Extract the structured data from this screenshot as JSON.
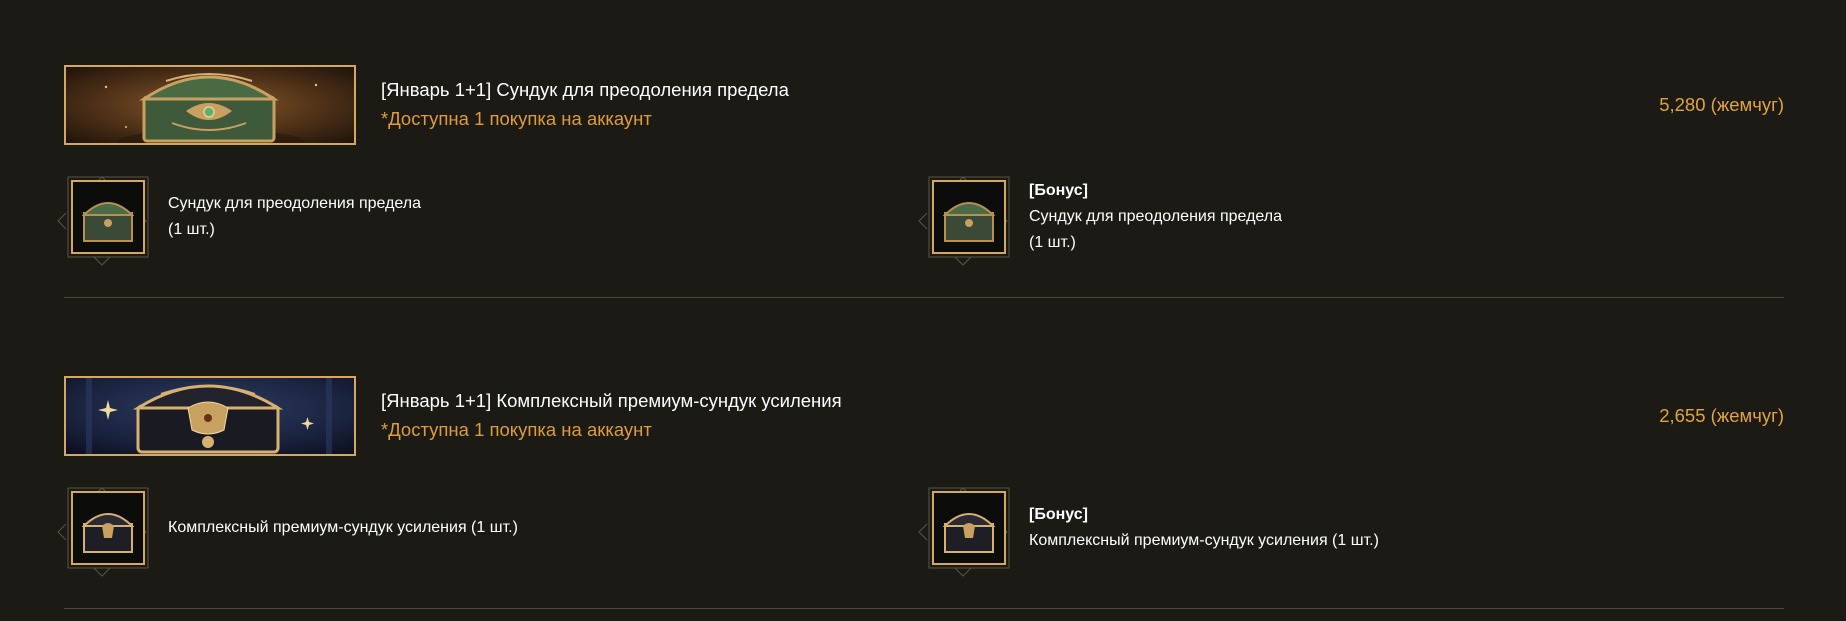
{
  "offers": [
    {
      "title": "[Январь 1+1] Сундук для преодоления предела",
      "limit": "*Доступна 1 покупка на аккаунт",
      "price": "5,280 (жемчуг)",
      "items": [
        {
          "bonus": "",
          "name": "Сундук для преодоления предела",
          "qty": "(1 шт.)"
        },
        {
          "bonus": "[Бонус]",
          "name": "Сундук для преодоления предела",
          "qty": "(1 шт.)"
        }
      ],
      "theme": {
        "banner_bg": "#6b4a24",
        "chest": "#3e5a3a",
        "trim": "#c8a060"
      }
    },
    {
      "title": "[Январь 1+1] Комплексный премиум-сундук усиления",
      "limit": "*Доступна 1 покупка на аккаунт",
      "price": "2,655 (жемчуг)",
      "items": [
        {
          "bonus": "",
          "name": "Комплексный премиум-сундук усиления (1 шт.)"
        },
        {
          "bonus": "[Бонус]",
          "name": "Комплексный премиум-сундук усиления (1 шт.)"
        }
      ],
      "theme": {
        "banner_bg": "#1e2a4a",
        "chest": "#1a1a22",
        "trim": "#d8b070"
      }
    }
  ],
  "colors": {
    "background": "#1b1a14",
    "accent": "#e0a440",
    "frame": "#d4a95f",
    "divider": "#4a463a"
  }
}
